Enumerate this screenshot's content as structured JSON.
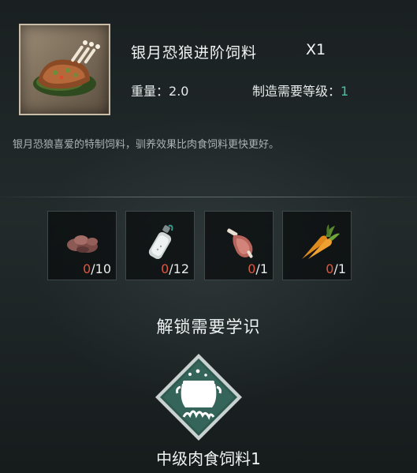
{
  "item": {
    "title": "银月恐狼进阶饲料",
    "quantity": "X1",
    "icon": "roast-rack-icon",
    "weight_label": "重量：",
    "weight_value": "2.0",
    "level_label": "制造需要等级：",
    "level_value": "1",
    "description": "银月恐狼喜爱的特制饲料，驯养效果比肉食饲料更快更好。"
  },
  "materials": [
    {
      "icon": "raw-meat-chunks-icon",
      "have": "0",
      "need": "/10"
    },
    {
      "icon": "salt-bottle-icon",
      "have": "0",
      "need": "/12"
    },
    {
      "icon": "ribs-meat-icon",
      "have": "0",
      "need": "/1"
    },
    {
      "icon": "carrot-icon",
      "have": "0",
      "need": "/1"
    }
  ],
  "unlock": {
    "title": "解锁需要学识",
    "recipe_icon": "cooking-pot-icon",
    "recipe_name": "中级肉食饲料1"
  },
  "colors": {
    "accent": "#48c2a8",
    "missing": "#e0563f",
    "diamond": "#2f5a4f"
  }
}
